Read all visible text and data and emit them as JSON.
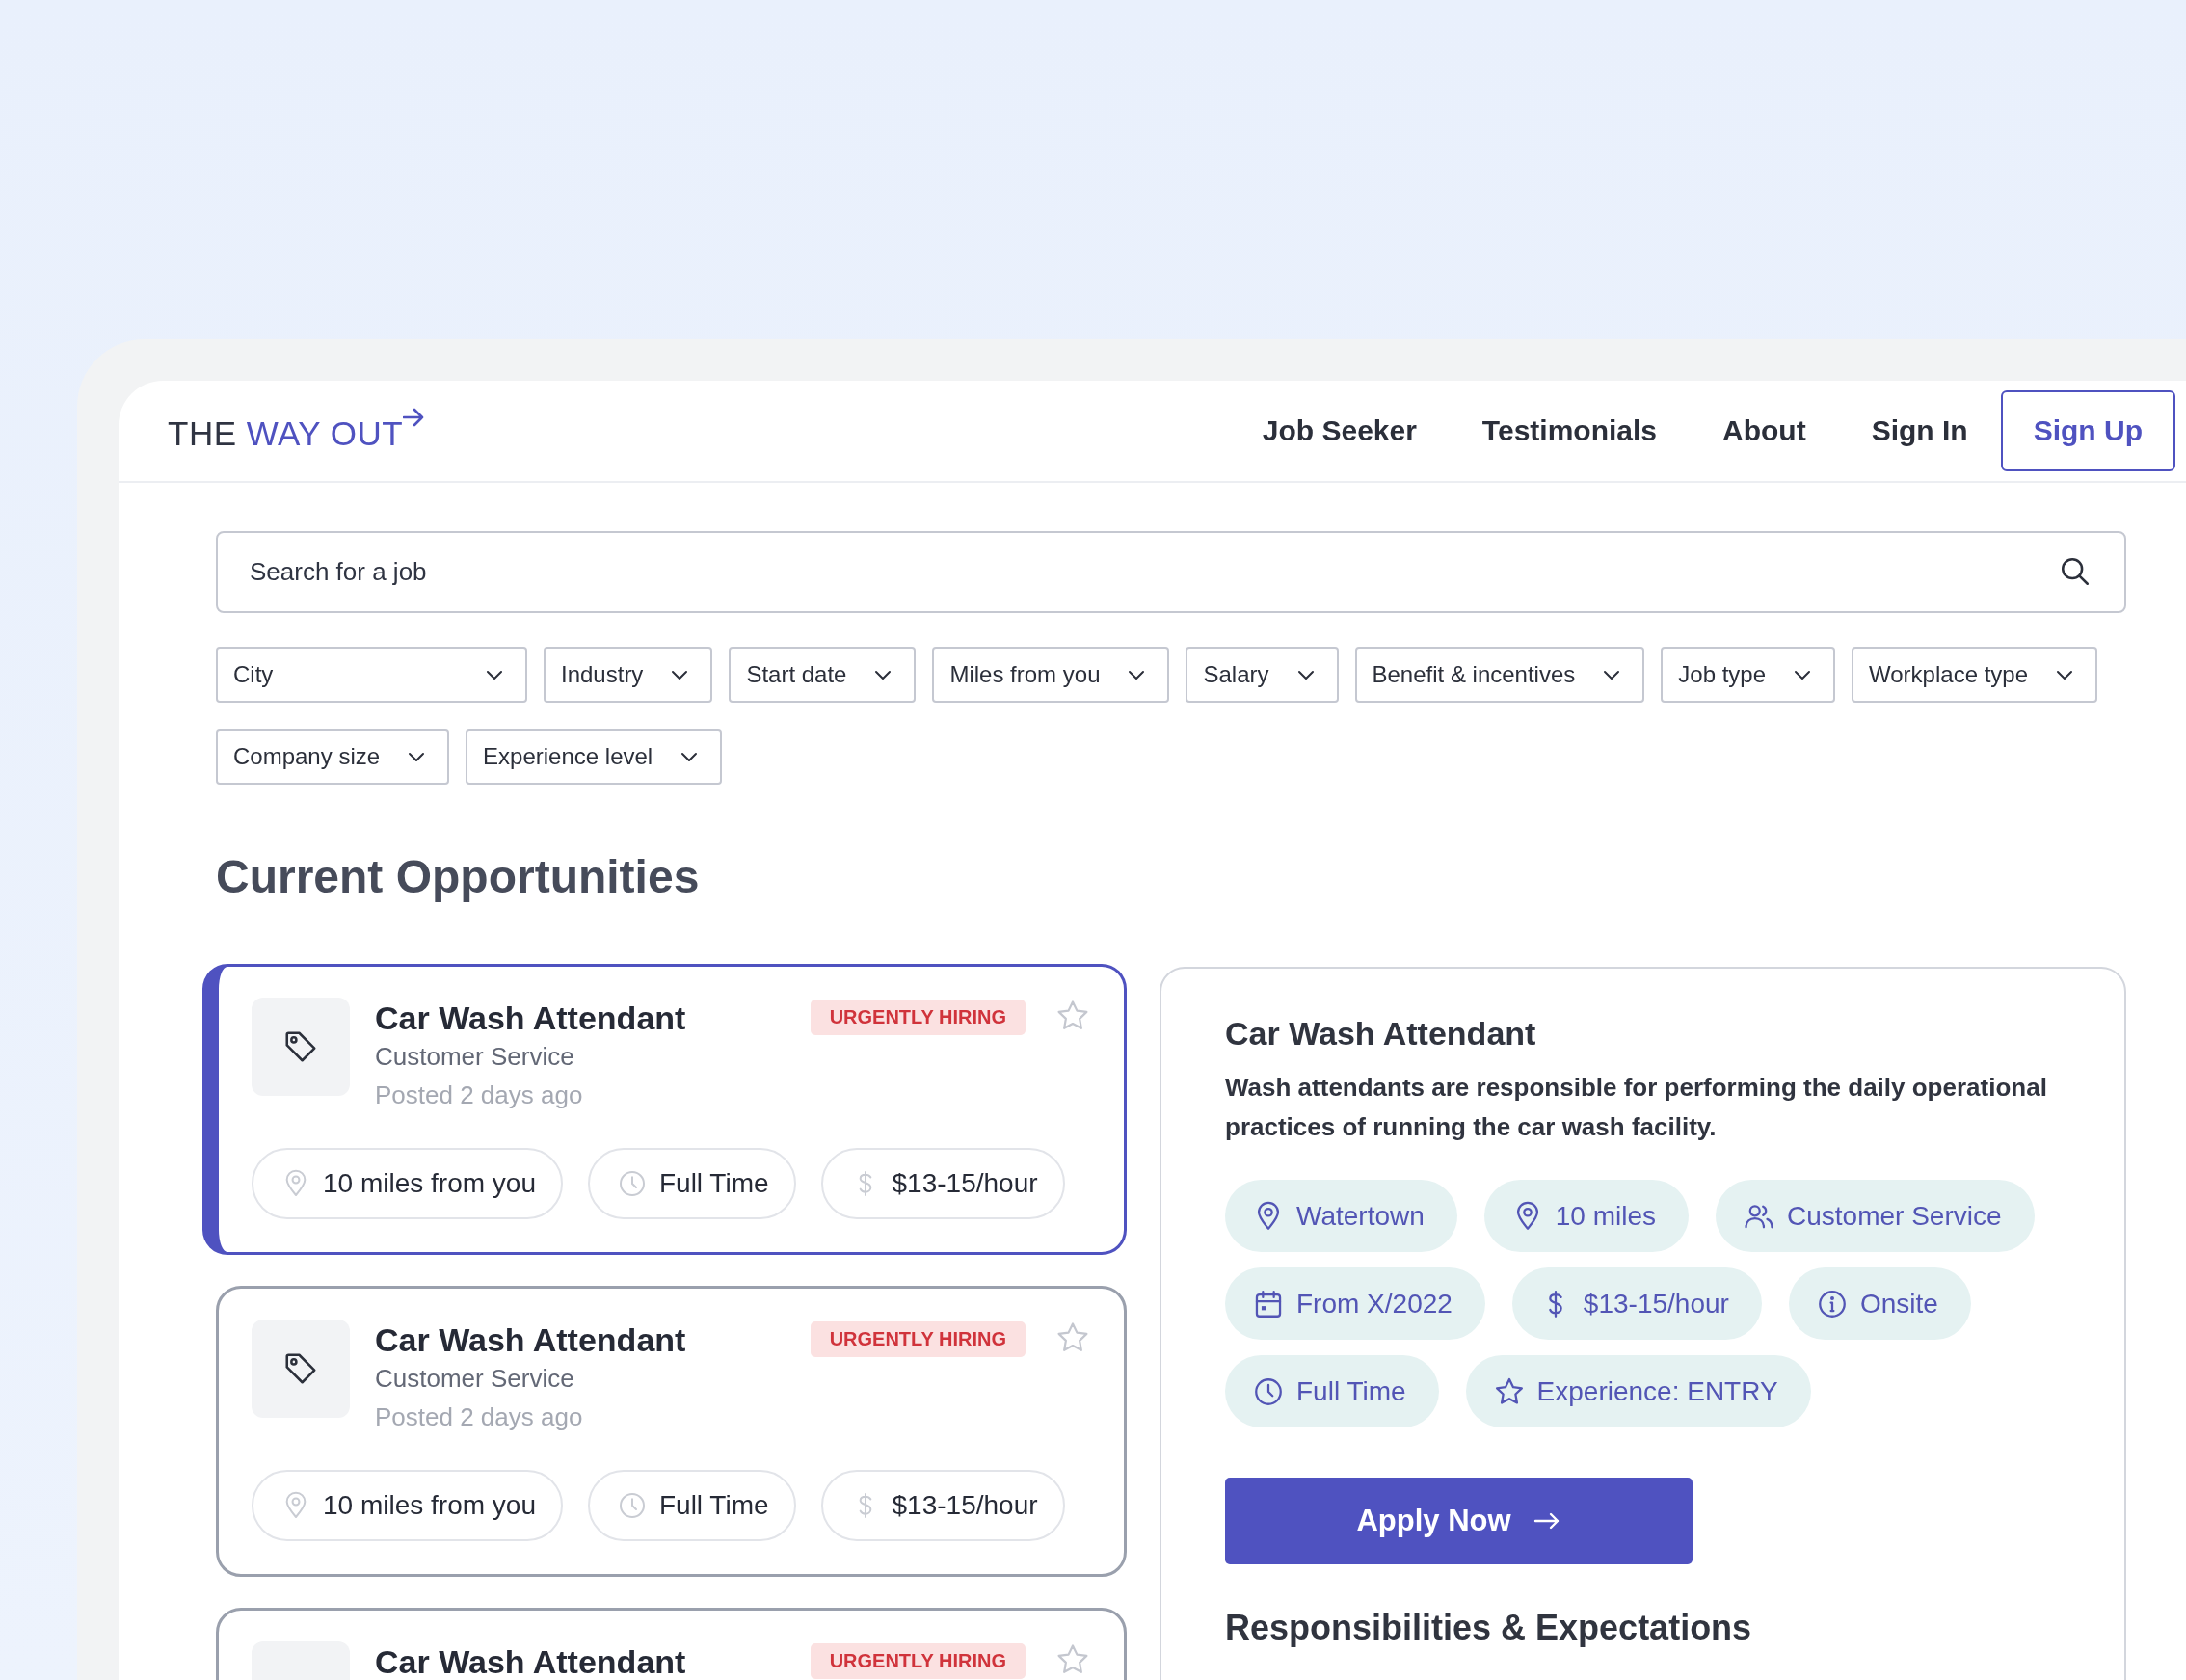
{
  "logo": {
    "prefix": "THE",
    "accent": "WAY OUT"
  },
  "nav": {
    "links": [
      "Job Seeker",
      "Testimonials",
      "About",
      "Sign In"
    ],
    "signup": "Sign Up"
  },
  "search": {
    "placeholder": "Search for a job"
  },
  "filters": [
    "City",
    "Industry",
    "Start date",
    "Miles from you",
    "Salary",
    "Benefit & incentives",
    "Job type",
    "Workplace type",
    "Company size",
    "Experience level"
  ],
  "heading": "Current Opportunities",
  "jobs": [
    {
      "title": "Car Wash Attendant",
      "category": "Customer Service",
      "posted": "Posted 2 days ago",
      "badge": "URGENTLY HIRING",
      "selected": true,
      "starred": false,
      "chips": [
        {
          "kind": "location",
          "text": "10 miles from you"
        },
        {
          "kind": "clock",
          "text": "Full Time"
        },
        {
          "kind": "dollar",
          "text": "$13-15/hour"
        }
      ]
    },
    {
      "title": "Car Wash Attendant",
      "category": "Customer Service",
      "posted": "Posted 2 days ago",
      "badge": "URGENTLY HIRING",
      "selected": false,
      "starred": false,
      "chips": [
        {
          "kind": "location",
          "text": "10 miles from you"
        },
        {
          "kind": "clock",
          "text": "Full Time"
        },
        {
          "kind": "dollar",
          "text": "$13-15/hour"
        }
      ]
    },
    {
      "title": "Car Wash Attendant",
      "badge": "URGENTLY HIRING",
      "selected": false,
      "starred": false
    }
  ],
  "detail": {
    "title": "Car Wash Attendant",
    "description": "Wash attendants are responsible for performing the daily operational practices of running the car wash facility.",
    "chips": [
      {
        "kind": "location",
        "text": "Watertown"
      },
      {
        "kind": "location",
        "text": "10 miles"
      },
      {
        "kind": "people",
        "text": "Customer Service"
      },
      {
        "kind": "calendar",
        "text": "From X/2022"
      },
      {
        "kind": "dollar",
        "text": "$13-15/hour"
      },
      {
        "kind": "info",
        "text": "Onsite"
      },
      {
        "kind": "clock",
        "text": "Full Time"
      },
      {
        "kind": "star",
        "text": "Experience: ENTRY"
      }
    ],
    "apply": "Apply Now",
    "section": "Responsibilities & Expectations"
  }
}
